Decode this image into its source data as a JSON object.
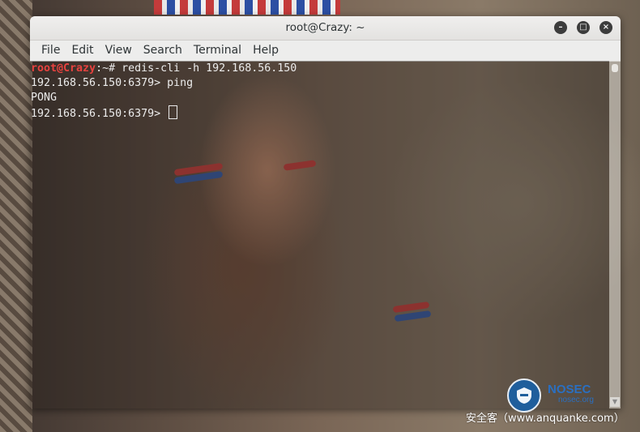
{
  "window": {
    "title": "root@Crazy: ~",
    "buttons": [
      "minimize",
      "maximize",
      "close"
    ]
  },
  "menubar": {
    "items": [
      "File",
      "Edit",
      "View",
      "Search",
      "Terminal",
      "Help"
    ]
  },
  "terminal": {
    "prompt_user": "root@Crazy",
    "prompt_suffix": ":~# ",
    "command": "redis-cli -h 192.168.56.150",
    "lines": [
      "192.168.56.150:6379> ping",
      "PONG",
      "192.168.56.150:6379> "
    ],
    "colors": {
      "user": "#e8423f",
      "text": "#ececec"
    }
  },
  "watermark": {
    "brand": "NOSEC",
    "brand_sub": "nosec.org",
    "site": "安全客（www.anquanke.com）"
  },
  "icons": {
    "minimize": "minimize-icon",
    "maximize": "maximize-icon",
    "close": "close-icon",
    "logo": "nosec-shield-icon"
  }
}
